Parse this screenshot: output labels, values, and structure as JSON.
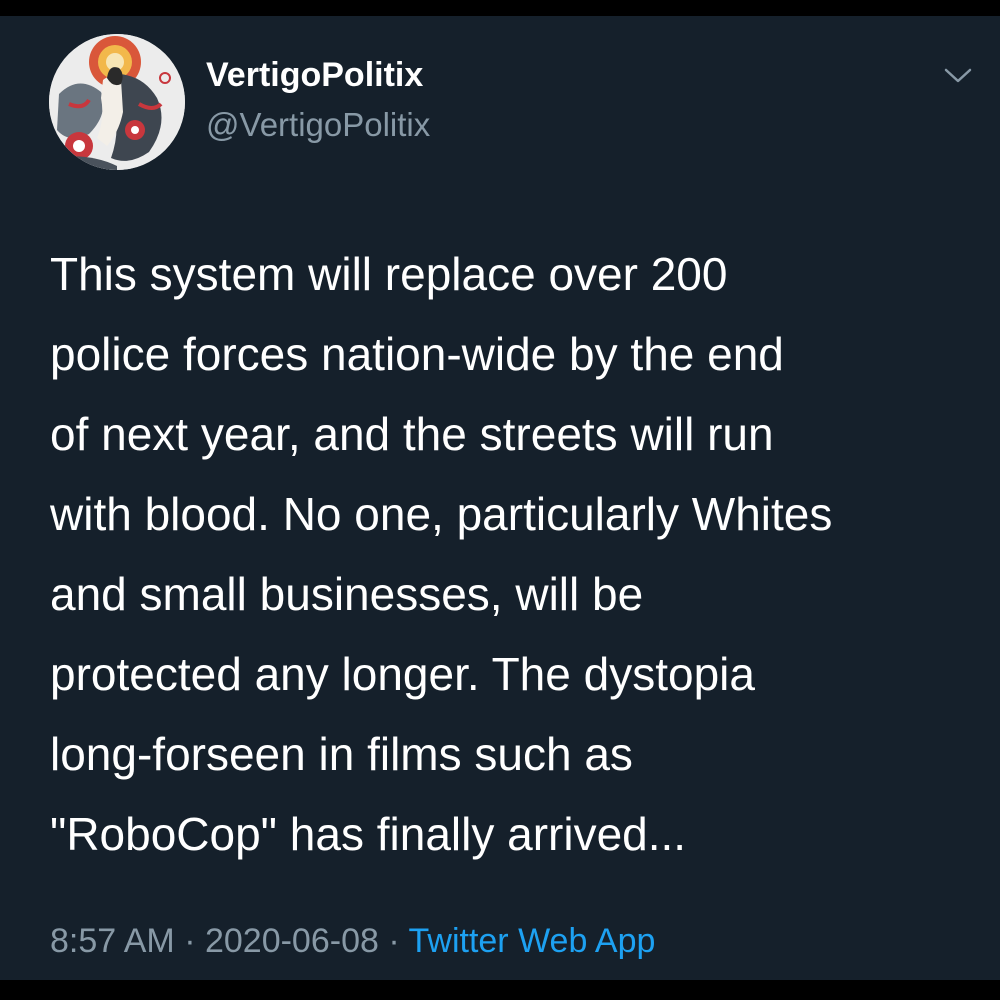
{
  "colors": {
    "background": "#15202b",
    "frame": "#000000",
    "text_primary": "#ffffff",
    "text_secondary": "#8899a6",
    "link": "#1da1f2"
  },
  "author": {
    "display_name": "VertigoPolitix",
    "handle": "@VertigoPolitix",
    "avatar_icon": "illustrated-artwork-avatar"
  },
  "menu_icon": "chevron-down-icon",
  "tweet": {
    "lines": [
      "This system will replace over 200",
      "police forces nation-wide by the end",
      "of next year, and the streets will run",
      "with blood. No one, particularly Whites",
      "and small businesses, will be",
      "protected any longer. The dystopia",
      "long-forseen in films such as",
      "\"RoboCop\" has finally arrived..."
    ]
  },
  "meta": {
    "time": "8:57 AM",
    "separator": " · ",
    "date": "2020-06-08",
    "source": "Twitter Web App"
  }
}
